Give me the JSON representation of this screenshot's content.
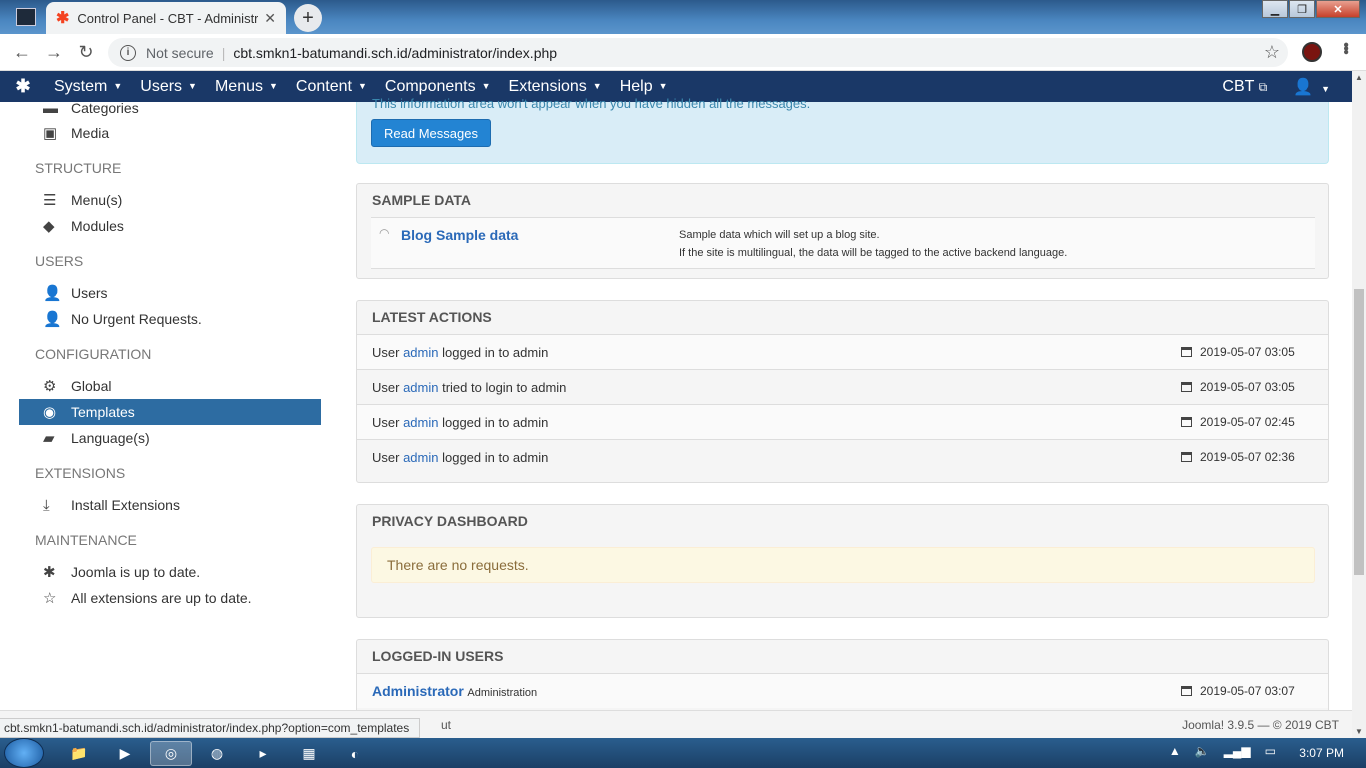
{
  "browser": {
    "tab_title": "Control Panel - CBT - Administrat",
    "tab_close": "✕",
    "new_tab": "+",
    "not_secure": "Not secure",
    "url": "cbt.smkn1-batumandi.sch.id/administrator/index.php",
    "status_url": "cbt.smkn1-batumandi.sch.id/administrator/index.php?option=com_templates"
  },
  "navbar": {
    "items": [
      "System",
      "Users",
      "Menus",
      "Content",
      "Components",
      "Extensions",
      "Help"
    ],
    "site": "CBT",
    "user_icon": "user-icon"
  },
  "sidebar": {
    "items_top": [
      {
        "label": "Categories",
        "icon": "folder-icon"
      },
      {
        "label": "Media",
        "icon": "image-icon"
      }
    ],
    "structure_heading": "STRUCTURE",
    "structure_items": [
      "Menu(s)",
      "Modules"
    ],
    "users_heading": "USERS",
    "users_items": [
      "Users",
      "No Urgent Requests."
    ],
    "config_heading": "CONFIGURATION",
    "config_items": [
      "Global",
      "Templates",
      "Language(s)"
    ],
    "extensions_heading": "EXTENSIONS",
    "extensions_items": [
      "Install Extensions"
    ],
    "maintenance_heading": "MAINTENANCE",
    "maintenance_items": [
      "Joomla is up to date.",
      "All extensions are up to date."
    ]
  },
  "messages": {
    "cut_text": "This information area won't appear when you have hidden all the messages.",
    "read_button": "Read Messages"
  },
  "sample_data": {
    "heading": "SAMPLE DATA",
    "name": "Blog Sample data",
    "desc1": "Sample data which will set up a blog site.",
    "desc2": "If the site is multilingual, the data will be tagged to the active backend language."
  },
  "latest_actions": {
    "heading": "LATEST ACTIONS",
    "rows": [
      {
        "pre": "User ",
        "user": "admin",
        "post": " logged in to admin",
        "date": "2019-05-07 03:05"
      },
      {
        "pre": "User ",
        "user": "admin",
        "post": " tried to login to admin",
        "date": "2019-05-07 03:05"
      },
      {
        "pre": "User ",
        "user": "admin",
        "post": " logged in to admin",
        "date": "2019-05-07 02:45"
      },
      {
        "pre": "User ",
        "user": "admin",
        "post": " logged in to admin",
        "date": "2019-05-07 02:36"
      }
    ]
  },
  "privacy": {
    "heading": "PRIVACY DASHBOARD",
    "notice": "There are no requests."
  },
  "logged_in": {
    "heading": "LOGGED-IN USERS",
    "name": "Administrator",
    "area": "Administration",
    "date": "2019-05-07 03:07"
  },
  "footer": {
    "logout_fragment": "ut",
    "version": "Joomla! 3.9.5  —  © 2019 CBT"
  },
  "taskbar": {
    "clock": "3:07 PM"
  }
}
